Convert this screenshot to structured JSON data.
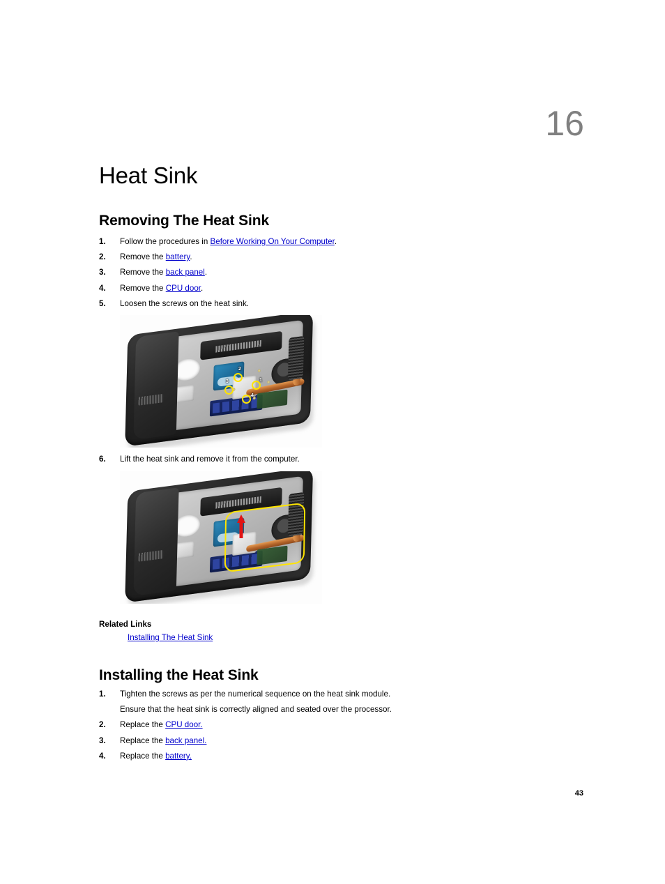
{
  "document": {
    "chapter_number": "16",
    "chapter_title": "Heat Sink",
    "page_number": "43"
  },
  "removing": {
    "heading": "Removing The Heat Sink",
    "steps": [
      {
        "num": "1.",
        "prefix": "Follow the procedures in ",
        "link": "Before Working On Your Computer",
        "suffix": "."
      },
      {
        "num": "2.",
        "prefix": "Remove the ",
        "link": "battery",
        "suffix": "."
      },
      {
        "num": "3.",
        "prefix": "Remove the ",
        "link": "back panel",
        "suffix": "."
      },
      {
        "num": "4.",
        "prefix": "Remove the ",
        "link": "CPU door",
        "suffix": "."
      },
      {
        "num": "5.",
        "prefix": "Loosen the screws on the heat sink.",
        "link": "",
        "suffix": ""
      },
      {
        "num": "6.",
        "prefix": "Lift the heat sink and remove it from the computer.",
        "link": "",
        "suffix": ""
      }
    ]
  },
  "figures": {
    "loosen_screws": {
      "caption": "laptop-bottom-heat-sink-screws-photo",
      "screw_labels": [
        "1",
        "2",
        "3",
        "4"
      ]
    },
    "lift_heatsink": {
      "caption": "laptop-bottom-heat-sink-removal-photo"
    }
  },
  "related_links": {
    "title": "Related Links",
    "items": [
      {
        "label": "Installing The Heat Sink"
      }
    ]
  },
  "installing": {
    "heading": "Installing the Heat Sink",
    "steps": [
      {
        "num": "1.",
        "prefix": "Tighten the screws as per the numerical sequence on the heat sink module.",
        "link": "",
        "suffix": "",
        "subtext": "Ensure that the heat sink is correctly aligned and seated over the processor."
      },
      {
        "num": "2.",
        "prefix": "Replace the ",
        "link": "CPU door.",
        "suffix": ""
      },
      {
        "num": "3.",
        "prefix": "Replace the ",
        "link": "back panel.",
        "suffix": ""
      },
      {
        "num": "4.",
        "prefix": "Replace the ",
        "link": "battery.",
        "suffix": ""
      }
    ]
  },
  "colors": {
    "link": "#0000CC",
    "chapter_number": "#808080",
    "annotation_highlight": "#FFE400",
    "annotation_arrow": "#E11414"
  }
}
